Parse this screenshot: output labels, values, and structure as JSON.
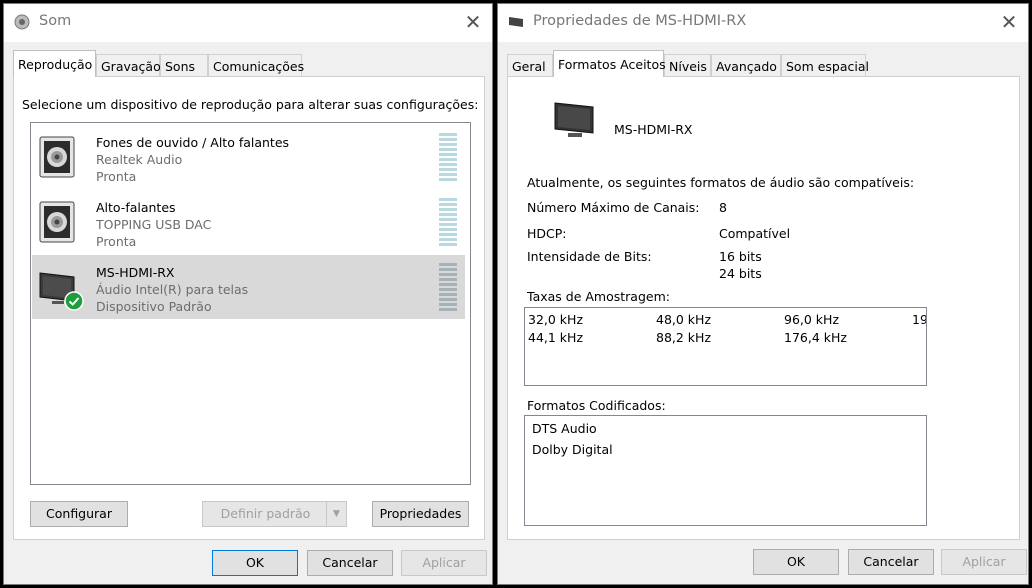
{
  "sound": {
    "title": "Som",
    "tabs": [
      "Reprodução",
      "Gravação",
      "Sons",
      "Comunicações"
    ],
    "instruction": "Selecione um dispositivo de reprodução para alterar suas configurações:",
    "devices": [
      {
        "name": "Fones de ouvido / Alto falantes",
        "detail": "Realtek Audio",
        "status": "Pronta",
        "icon": "speaker-icon"
      },
      {
        "name": "Alto-falantes",
        "detail": "TOPPING USB DAC",
        "status": "Pronta",
        "icon": "speaker-icon"
      },
      {
        "name": "MS-HDMI-RX",
        "detail": "Áudio Intel(R) para telas",
        "status": "Dispositivo Padrão",
        "icon": "monitor-icon",
        "selected": true,
        "default_badge": "check-icon"
      }
    ],
    "buttons": {
      "configure": "Configurar",
      "set_default": "Definir padrão",
      "properties": "Propriedades",
      "ok": "OK",
      "cancel": "Cancelar",
      "apply": "Aplicar"
    }
  },
  "props": {
    "title": "Propriedades de MS-HDMI-RX",
    "tabs": [
      "Geral",
      "Formatos Aceitos",
      "Níveis",
      "Avançado",
      "Som espacial"
    ],
    "device_name": "MS-HDMI-RX",
    "intro": "Atualmente, os seguintes formatos de áudio são compatíveis:",
    "max_channels_label": "Número Máximo de Canais:",
    "max_channels_value": "8",
    "hdcp_label": "HDCP:",
    "hdcp_value": "Compatível",
    "bit_depth_label": "Intensidade de Bits:",
    "bit_depths": [
      "16 bits",
      "24 bits"
    ],
    "sample_rates_label": "Taxas de Amostragem:",
    "sample_rates": [
      "32,0 kHz",
      "48,0 kHz",
      "96,0 kHz",
      "19",
      "44,1 kHz",
      "88,2 kHz",
      "176,4 kHz"
    ],
    "encoded_label": "Formatos Codificados:",
    "encoded_formats": [
      "DTS Audio",
      "Dolby Digital"
    ],
    "buttons": {
      "ok": "OK",
      "cancel": "Cancelar",
      "apply": "Aplicar"
    }
  },
  "colors": {
    "accent": "#0078d7",
    "selection": "#d9d9d9",
    "check": "#1e9e3c"
  }
}
